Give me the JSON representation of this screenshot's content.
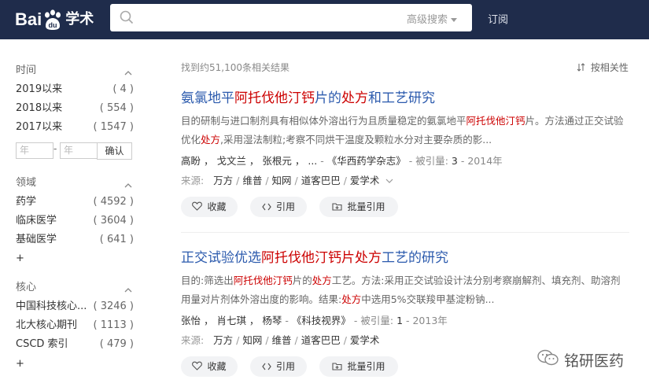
{
  "header": {
    "logo_left": "Bai",
    "logo_paw": "du",
    "logo_right": "学术",
    "search_placeholder": "",
    "advanced_search": "高级搜索",
    "subscribe": "订阅"
  },
  "sidebar": {
    "time": {
      "title": "时间",
      "items": [
        {
          "label": "2019以来",
          "count": "( 4 )"
        },
        {
          "label": "2018以来",
          "count": "( 554 )"
        },
        {
          "label": "2017以来",
          "count": "( 1547 )"
        }
      ],
      "from_placeholder": "年",
      "sep": "-",
      "to_placeholder": "年",
      "confirm": "确认"
    },
    "field": {
      "title": "领域",
      "items": [
        {
          "label": "药学",
          "count": "( 4592 )"
        },
        {
          "label": "临床医学",
          "count": "( 3604 )"
        },
        {
          "label": "基础医学",
          "count": "( 641 )"
        }
      ],
      "more": "+"
    },
    "core": {
      "title": "核心",
      "items": [
        {
          "label": "中国科技核心...",
          "count": "( 3246 )"
        },
        {
          "label": "北大核心期刊",
          "count": "( 1113 )"
        },
        {
          "label": "CSCD 索引",
          "count": "( 479 )"
        }
      ],
      "more": "+"
    }
  },
  "main": {
    "result_count": "找到约51,100条相关结果",
    "sort_label": "按相关性",
    "results": [
      {
        "title": [
          {
            "t": "氨氯地平",
            "hl": false
          },
          {
            "t": "阿托伐他汀钙",
            "hl": true
          },
          {
            "t": "片的",
            "hl": false
          },
          {
            "t": "处方",
            "hl": true
          },
          {
            "t": "和工艺研究",
            "hl": false
          }
        ],
        "abstract": [
          {
            "t": "目的研制与进口制剂具有相似体外溶出行为且质量稳定的氨氯地平",
            "hl": false
          },
          {
            "t": "阿托伐他汀钙",
            "hl": true
          },
          {
            "t": "片。方法通过正交试验优化",
            "hl": false
          },
          {
            "t": "处方",
            "hl": true
          },
          {
            "t": ",采用湿法制粒;考察不同烘干温度及颗粒水分对主要杂质的影...",
            "hl": false
          }
        ],
        "authors": "高盼 ， 戈文兰 ， 张根元 ， ...",
        "journal": "《华西药学杂志》",
        "cited_label": "被引量:",
        "cited": "3",
        "year": "2014年",
        "source_label": "来源:",
        "sources": [
          "万方",
          "维普",
          "知网",
          "道客巴巴",
          "爱学术"
        ],
        "actions": {
          "collect": "收藏",
          "cite": "引用",
          "batch": "批量引用"
        }
      },
      {
        "title": [
          {
            "t": "正交试验优选",
            "hl": false
          },
          {
            "t": "阿托伐他汀钙片处方",
            "hl": true
          },
          {
            "t": "工艺的研究",
            "hl": false
          }
        ],
        "abstract": [
          {
            "t": "目的:筛选出",
            "hl": false
          },
          {
            "t": "阿托伐他汀钙",
            "hl": true
          },
          {
            "t": "片的",
            "hl": false
          },
          {
            "t": "处方",
            "hl": true
          },
          {
            "t": "工艺。方法:采用正交试验设计法分别考察崩解剂、填充剂、助溶剂用量对片剂体外溶出度的影响。结果:",
            "hl": false
          },
          {
            "t": "处方",
            "hl": true
          },
          {
            "t": "中选用5%交联羧甲基淀粉钠...",
            "hl": false
          }
        ],
        "authors": "张怡 ， 肖七琪 ， 杨琴",
        "journal": "《科技视界》",
        "cited_label": "被引量:",
        "cited": "1",
        "year": "2013年",
        "source_label": "来源:",
        "sources": [
          "万方",
          "知网",
          "维普",
          "道客巴巴",
          "爱学术"
        ],
        "actions": {
          "collect": "收藏",
          "cite": "引用",
          "batch": "批量引用"
        }
      }
    ]
  },
  "watermark": "铭研医药"
}
